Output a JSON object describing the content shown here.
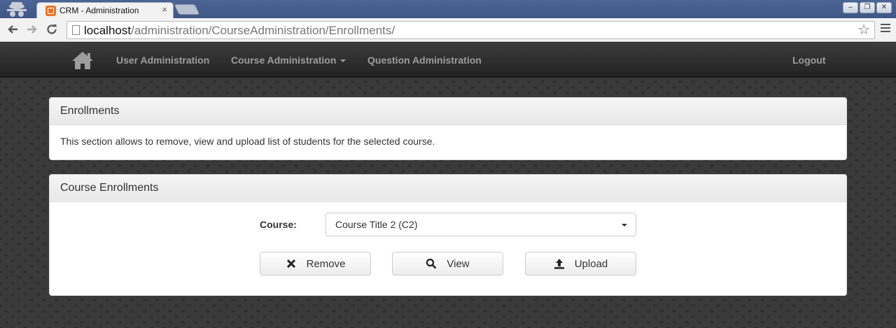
{
  "browser": {
    "tab_title": "CRM - Administration",
    "tab_close": "×",
    "url_host": "localhost",
    "url_path": "/administration/CourseAdministration/Enrollments/",
    "window_buttons": [
      "–",
      "❐",
      "✕"
    ]
  },
  "navbar": {
    "home_icon": "home-icon",
    "items": [
      {
        "label": "User Administration"
      },
      {
        "label": "Course Administration",
        "dropdown": true
      },
      {
        "label": "Question Administration"
      }
    ],
    "logout": "Logout"
  },
  "enrollments_panel": {
    "title": "Enrollments",
    "description": "This section allows to remove, view and upload list of students for the selected course."
  },
  "course_panel": {
    "title": "Course Enrollments",
    "course_label": "Course:",
    "selected_course": "Course Title 2 (C2)",
    "buttons": {
      "remove": "Remove",
      "view": "View",
      "upload": "Upload"
    }
  }
}
